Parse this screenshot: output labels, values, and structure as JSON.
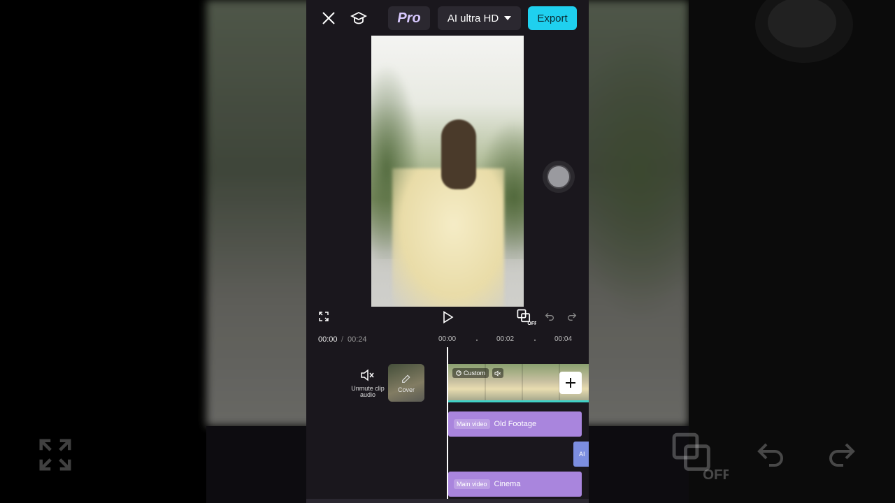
{
  "topbar": {
    "pro_label": "Pro",
    "quality_label": "AI ultra HD",
    "export_label": "Export"
  },
  "timeline": {
    "current_time": "00:00",
    "separator": "/",
    "total_time": "00:24",
    "ruler_labels": [
      "00:00",
      "00:02",
      "00:04"
    ]
  },
  "side_tools": {
    "unmute_label": "Unmute clip audio",
    "cover_label": "Cover"
  },
  "clip": {
    "custom_tag": "Custom"
  },
  "tracks": [
    {
      "badge": "Main video",
      "name": "Old Footage"
    },
    {
      "badge": "Main video",
      "name": "Cinema"
    }
  ],
  "small_clip_label": "AI",
  "colors": {
    "export_accent": "#1fd0ef",
    "track_color": "#a985dd",
    "secondary_clip": "#7c8ee0",
    "strip_underline": "#3fd1c6"
  },
  "icons": [
    "close-icon",
    "tutorial-cap-icon",
    "dropdown-caret-icon",
    "fullscreen-icon",
    "play-icon",
    "keyframe-off-icon",
    "undo-icon",
    "redo-icon",
    "mute-speaker-icon",
    "pencil-icon",
    "add-icon"
  ]
}
